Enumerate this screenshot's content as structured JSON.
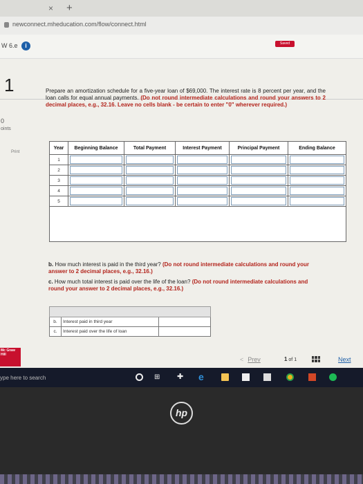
{
  "browser": {
    "tab_close": "×",
    "tab_new": "+",
    "url": "newconnect.mheducation.com/flow/connect.html"
  },
  "app": {
    "assignment": "W 6.e",
    "info_icon": "i",
    "saved": "Saved"
  },
  "question": {
    "number": "1",
    "points_value": "0",
    "points_label": "oints",
    "print": "Print",
    "prompt_plain": "Prepare an amortization schedule for a five-year loan of $69,000. The interest rate is 8 percent per year, and the loan calls for equal annual payments.",
    "prompt_red": "(Do not round intermediate calculations and round your answers to 2 decimal places, e.g., 32.16. Leave no cells blank - be certain to enter \"0\" wherever required.)"
  },
  "schedule": {
    "headers": [
      "Year",
      "Beginning Balance",
      "Total Payment",
      "Interest Payment",
      "Principal Payment",
      "Ending Balance"
    ],
    "years": [
      "1",
      "2",
      "3",
      "4",
      "5"
    ]
  },
  "subquestions": {
    "b_label": "b.",
    "b_text": "How much interest is paid in the third year?",
    "b_red": "(Do not round intermediate calculations and round your answer to 2 decimal places, e.g., 32.16.)",
    "c_label": "c.",
    "c_text": "How much total interest is paid over the life of the loan?",
    "c_red": "(Do not round intermediate calculations and round your answer to 2 decimal places, e.g., 32.16.)"
  },
  "answers": [
    {
      "letter": "b.",
      "text": "Interest paid in third year"
    },
    {
      "letter": "c.",
      "text": "Interest paid over the life of loan"
    }
  ],
  "nav": {
    "logo": "Mc Graw Hill",
    "prev_arrow": "<",
    "prev": "Prev",
    "page_current": "1",
    "page_of": "of 1",
    "next": "Next"
  },
  "taskbar": {
    "search": "ype here to search"
  },
  "device": {
    "logo": "hp"
  }
}
